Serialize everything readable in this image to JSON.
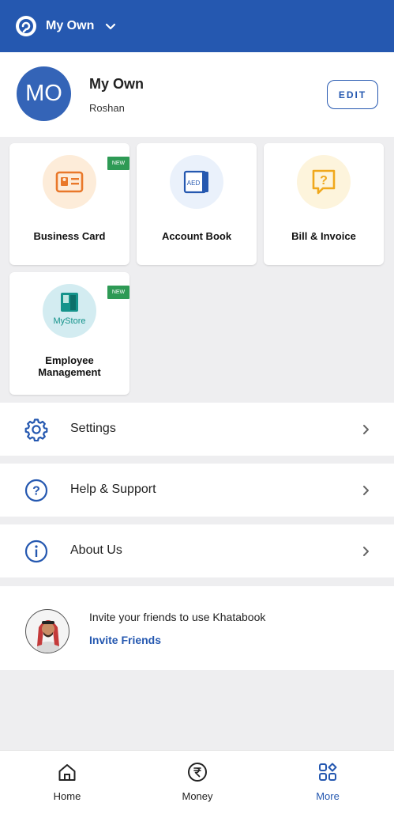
{
  "header": {
    "business_name": "My Own",
    "logo_icon": "khatabook-logo-icon",
    "dropdown_icon": "chevron-down-icon",
    "brand_color": "#2558b0"
  },
  "profile": {
    "avatar_initials": "MO",
    "name": "My Own",
    "subtitle": "Roshan",
    "edit_label": "EDIT"
  },
  "tiles": [
    {
      "label": "Business Card",
      "icon": "business-card-icon",
      "badge": "NEW"
    },
    {
      "label": "Account Book",
      "icon": "account-book-icon",
      "icon_text": "AED"
    },
    {
      "label": "Bill & Invoice",
      "icon": "bill-invoice-icon"
    },
    {
      "label": "Employee Management",
      "icon": "mystore-icon",
      "icon_text": "MyStore",
      "badge": "NEW"
    }
  ],
  "menu": [
    {
      "label": "Settings",
      "icon": "settings-icon"
    },
    {
      "label": "Help & Support",
      "icon": "help-icon"
    },
    {
      "label": "About Us",
      "icon": "info-icon"
    }
  ],
  "invite": {
    "text": "Invite your friends to use Khatabook",
    "link": "Invite Friends"
  },
  "bottom_nav": [
    {
      "label": "Home",
      "icon": "home-icon",
      "active": false
    },
    {
      "label": "Money",
      "icon": "rupee-icon",
      "active": false
    },
    {
      "label": "More",
      "icon": "grid-icon",
      "active": true
    }
  ]
}
